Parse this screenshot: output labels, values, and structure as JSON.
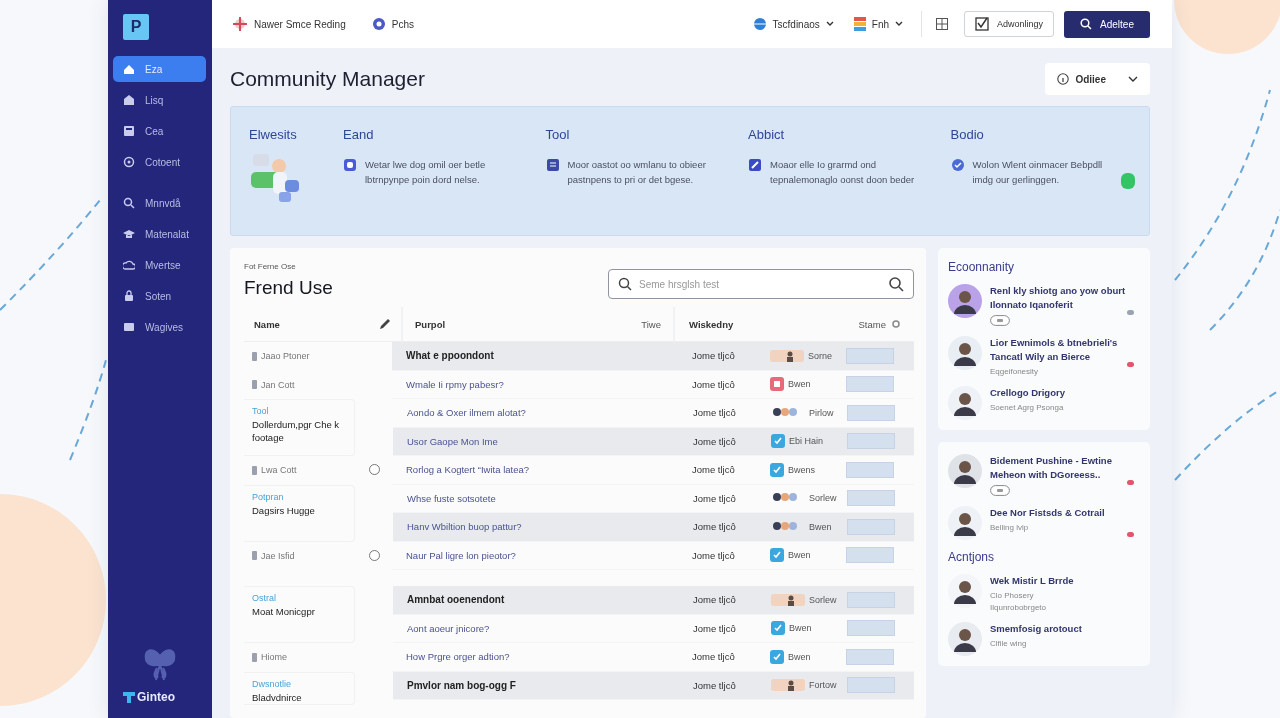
{
  "sidebar": {
    "logo": "P",
    "items": [
      {
        "label": "Eza",
        "selected": true
      },
      {
        "label": "Lisq",
        "selected": false
      },
      {
        "label": "Cea",
        "selected": false
      },
      {
        "label": "Cotoent",
        "selected": false
      },
      {
        "label": "Mnnvdå",
        "selected": false
      },
      {
        "label": "Matenalat",
        "selected": false
      },
      {
        "label": "Mvertse",
        "selected": false
      },
      {
        "label": "Soten",
        "selected": false
      },
      {
        "label": "Wagives",
        "selected": false
      }
    ],
    "brand": "Ginteo"
  },
  "topbar": {
    "links": [
      "Nawer Smce Reding",
      "Pchs"
    ],
    "dropdowns": [
      "Tscfdinaos",
      "Fnh"
    ],
    "secondary_button": "Adwonlingy",
    "primary_button": "Adeltee"
  },
  "header": {
    "title": "Community Manager",
    "filter": "Odiiee"
  },
  "banner": {
    "label": "Elwesits",
    "toggle_on": true,
    "columns": [
      {
        "title": "Eand",
        "text": "Wetar lwe dog omil oer betle lbtrnpynpe poin dord nelse."
      },
      {
        "title": "Tool",
        "text": "Moor oastot oo wmlanu to obieer pastnpens to pri or det bgese."
      },
      {
        "title": "Abbict",
        "text": "Moaor elle Io grarmd ond tepnalemonaglo oonst doon beder"
      },
      {
        "title": "Bodio",
        "text": "Wolon Wlent oinmacer Bebpdll imdg our gerlinggen."
      }
    ]
  },
  "table": {
    "eyebrow": "Fot Ferne Ose",
    "title": "Frend Use",
    "search": {
      "placeholder": "Seme hrsglsh test"
    },
    "columns": [
      "Name",
      "Purpol",
      "Tiwe",
      "Wiskedny",
      "Stame"
    ],
    "groups": [
      {
        "name": "Jaao Ptoner",
        "rows": [
          {
            "topic": "What e ppoondont",
            "emphasized": true,
            "shaded": true,
            "author": "Jome tljcô",
            "status": "Sorne",
            "kind": "avatar"
          }
        ]
      },
      {
        "name": "Jan Cott",
        "rows": [
          {
            "topic": "Wmale Ii rpmy pabesr?",
            "emphasized": false,
            "shaded": false,
            "author": "Jome tljcô",
            "status": "Bwen",
            "kind": "square"
          }
        ]
      },
      {
        "tag": "Tool",
        "name": "Dollerdum,pgr Che k footage",
        "rows": [
          {
            "topic": "Aondo & Oxer ilmem alotat?",
            "emphasized": false,
            "shaded": false,
            "author": "Jome tljcô",
            "status": "Pirlow",
            "kind": "people"
          },
          {
            "topic": "Usor Gaope Mon Ime",
            "emphasized": false,
            "shaded": true,
            "author": "Jome tljcô",
            "status": "Ebi Hain",
            "kind": "check"
          }
        ]
      },
      {
        "name": "Lwa Cott",
        "radio": {
          "checked": false
        },
        "rows": [
          {
            "topic": "Rorlog a Kogtert “Iwita latea?",
            "emphasized": false,
            "shaded": false,
            "author": "Jome tljcô",
            "status": "Bwens",
            "kind": "check"
          }
        ]
      },
      {
        "tag": "Potpran",
        "name": "Dagsirs Hugge",
        "rows": [
          {
            "topic": "Whse fuste sotsotete",
            "emphasized": false,
            "shaded": false,
            "author": "Jome tljcô",
            "status": "Sorlew",
            "kind": "people"
          },
          {
            "topic": "Hanv Wbiltion buop pattur?",
            "emphasized": false,
            "shaded": true,
            "author": "Jome tljcô",
            "status": "Bwen",
            "kind": "people"
          }
        ]
      },
      {
        "name": "Jae Isfid",
        "radio": {
          "checked": false
        },
        "rows": [
          {
            "topic": "Naur Pal ligre lon pieotor?",
            "emphasized": false,
            "shaded": false,
            "author": "Jome tljcô",
            "status": "Bwen",
            "kind": "check"
          }
        ]
      },
      {
        "tag": "Ostral",
        "name": "Moat Monicgpr",
        "gap": true,
        "rows": [
          {
            "topic": "Amnbat ooenendont",
            "emphasized": true,
            "shaded": true,
            "author": "Jome tljcô",
            "status": "Sorlew",
            "kind": "avatar"
          },
          {
            "topic": "Aont aoeur jnicore?",
            "emphasized": false,
            "shaded": false,
            "author": "Jome tljcô",
            "status": "Bwen",
            "kind": "check"
          }
        ]
      },
      {
        "name": "Hiome",
        "rows": [
          {
            "topic": "How Prgre orger adtion?",
            "emphasized": false,
            "shaded": false,
            "author": "Jome tljcô",
            "status": "Bwen",
            "kind": "check"
          }
        ]
      },
      {
        "tag": "Dwsnotlie",
        "name": "Bladvdnirce",
        "rows": [
          {
            "topic": "Pmvlor nam bog-ogg F",
            "emphasized": true,
            "shaded": true,
            "author": "Jome tljcô",
            "status": "Fortow",
            "kind": "avatar"
          }
        ]
      }
    ]
  },
  "community": {
    "title": "Ecoonnanity",
    "cards": [
      {
        "items": [
          {
            "title": "Renl kly shiotg ano yow oburt Ilonnato Iqanoferit",
            "chip": true,
            "color": "#9aa3b0"
          },
          {
            "title": "Lior Ewnimols & btnebrieli's Tancatl Wily an Bierce",
            "sub": "Eqgeifonesity",
            "color": "#e0566a"
          },
          {
            "title": "Crellogo Drigory",
            "sub": "Soenet Agrg Psonga"
          }
        ]
      },
      {
        "items": [
          {
            "title": "Bidement Pushine - Ewtine Meheon with DGoreess..",
            "chip": true,
            "color": "#e0566a"
          },
          {
            "title": "Dee Nor Fistsds & Cotrail",
            "sub": "Belling lvip",
            "color": "#e0566a"
          }
        ],
        "heading": "Acntjons",
        "more": [
          {
            "title": "Wek Mistir L Brrde",
            "sub": "Clo Phosery",
            "sub2": "Ilqunrobobrgeto"
          },
          {
            "title": "Smemfosig arotouct",
            "sub": "Clfile wing"
          }
        ]
      }
    ]
  }
}
